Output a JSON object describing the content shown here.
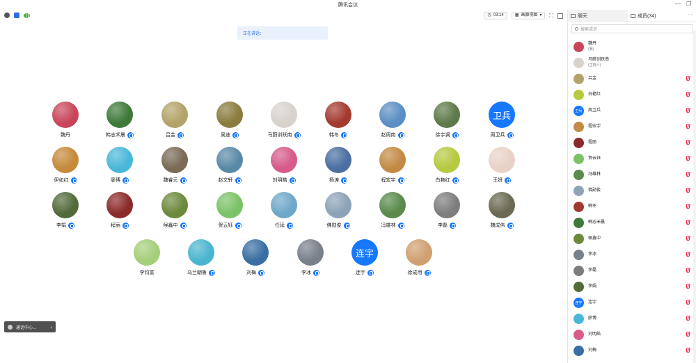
{
  "app": {
    "title": "腾讯会议"
  },
  "toolbar": {
    "timer": "03:14",
    "view_label": "画廊视图"
  },
  "speaking": {
    "label": "正在讲话："
  },
  "participants": [
    {
      "name": "魏丹",
      "avatar_color": "#c9465a",
      "mic": "none"
    },
    {
      "name": "韩志禾晨",
      "avatar_color": "#3f7a3a",
      "mic": "on"
    },
    {
      "name": "吕金",
      "avatar_color": "#b3a36a",
      "mic": "on"
    },
    {
      "name": "吴迪",
      "avatar_color": "#8a7c3c",
      "mic": "on"
    },
    {
      "name": "马蔚训跃南",
      "avatar_color": "#d7d2cc",
      "mic": "on"
    },
    {
      "name": "韩冬",
      "avatar_color": "#a33a2f",
      "mic": "on"
    },
    {
      "name": "赵周南",
      "avatar_color": "#5b8fc4",
      "mic": "on"
    },
    {
      "name": "徐宇澜",
      "avatar_color": "#5e7a4a",
      "mic": "on"
    },
    {
      "name": "周卫兵",
      "avatar_text": "卫兵",
      "mic": "on"
    },
    {
      "name": "伊如红",
      "avatar_color": "#c58a3a",
      "mic": "on"
    },
    {
      "name": "廖博",
      "avatar_color": "#4ab7d9",
      "mic": "on"
    },
    {
      "name": "魏睿元",
      "avatar_color": "#7a6a56",
      "mic": "on"
    },
    {
      "name": "赵文轩",
      "avatar_color": "#5a89a8",
      "mic": "on"
    },
    {
      "name": "刘明皓",
      "avatar_color": "#d65a8a",
      "mic": "on"
    },
    {
      "name": "杨涛",
      "avatar_color": "#4a6fa0",
      "mic": "on"
    },
    {
      "name": "程宏宇",
      "avatar_color": "#c28a44",
      "mic": "on"
    },
    {
      "name": "白艳红",
      "avatar_color": "#b7c93f",
      "mic": "on"
    },
    {
      "name": "王妍",
      "avatar_color": "#e8d2c7",
      "mic": "on"
    },
    {
      "name": "李娟",
      "avatar_color": "#526b3a",
      "mic": "on"
    },
    {
      "name": "程丽",
      "avatar_color": "#8b2a2a",
      "mic": "on"
    },
    {
      "name": "候鑫中",
      "avatar_color": "#6c8a3c",
      "mic": "on"
    },
    {
      "name": "贺云钰",
      "avatar_color": "#7cc268",
      "mic": "on"
    },
    {
      "name": "任延",
      "avatar_color": "#6fa7c9",
      "mic": "on"
    },
    {
      "name": "佛勋俊",
      "avatar_color": "#8da3b8",
      "mic": "on"
    },
    {
      "name": "冯雄林",
      "avatar_color": "#5a8a4c",
      "mic": "on"
    },
    {
      "name": "李磊",
      "avatar_color": "#7d7d7d",
      "mic": "on"
    },
    {
      "name": "魏成伟",
      "avatar_color": "#6a6a52",
      "mic": "on"
    },
    {
      "name": "李钧富",
      "avatar_color": "#a5cf7a",
      "mic": "none"
    },
    {
      "name": "乌兰朝鲁",
      "avatar_color": "#4ab5cf",
      "mic": "on"
    },
    {
      "name": "刘梅",
      "avatar_color": "#3a6fa3",
      "mic": "on"
    },
    {
      "name": "李冰",
      "avatar_color": "#78808a",
      "mic": "on"
    },
    {
      "name": "连宇",
      "avatar_text": "连宇",
      "mic": "on"
    },
    {
      "name": "徐成用",
      "avatar_color": "#d0a070",
      "mic": "on"
    }
  ],
  "status_bar": {
    "label": "通话中心..."
  },
  "panel": {
    "tabs": [
      {
        "label": "聊天"
      },
      {
        "label": "成员(34)"
      }
    ],
    "more_label": "···",
    "search_placeholder": "搜索成员",
    "members": [
      {
        "name": "魏丹",
        "sub": "(我)",
        "color": "#c9465a",
        "mic": "none"
      },
      {
        "name": "马蔚训跃南",
        "sub": "(主持人)",
        "color": "#d7d2cc",
        "mic": "none"
      },
      {
        "name": "吕金",
        "color": "#b3a36a",
        "mic": "off"
      },
      {
        "name": "白艳红",
        "color": "#b7c93f",
        "mic": "off"
      },
      {
        "name": "周卫兵",
        "text": "卫兵",
        "mic": "off"
      },
      {
        "name": "程宏宇",
        "color": "#c28a44",
        "mic": "off"
      },
      {
        "name": "程丽",
        "color": "#8b2a2a",
        "mic": "off"
      },
      {
        "name": "贺云钰",
        "color": "#7cc268",
        "mic": "off"
      },
      {
        "name": "冯雄林",
        "color": "#5a8a4c",
        "mic": "off"
      },
      {
        "name": "佛勋俊",
        "color": "#8da3b8",
        "mic": "off"
      },
      {
        "name": "韩冬",
        "color": "#a33a2f",
        "mic": "off"
      },
      {
        "name": "韩志禾晨",
        "color": "#3f7a3a",
        "mic": "off"
      },
      {
        "name": "候鑫中",
        "color": "#6c8a3c",
        "mic": "off"
      },
      {
        "name": "李冰",
        "color": "#78808a",
        "mic": "off"
      },
      {
        "name": "李磊",
        "color": "#7d7d7d",
        "mic": "off"
      },
      {
        "name": "李娟",
        "color": "#526b3a",
        "mic": "off"
      },
      {
        "name": "连宇",
        "text": "连宇",
        "mic": "off"
      },
      {
        "name": "廖博",
        "color": "#4ab7d9",
        "mic": "off"
      },
      {
        "name": "刘明皓",
        "color": "#d65a8a",
        "mic": "off"
      },
      {
        "name": "刘梅",
        "color": "#3a6fa3",
        "mic": "off"
      }
    ]
  }
}
